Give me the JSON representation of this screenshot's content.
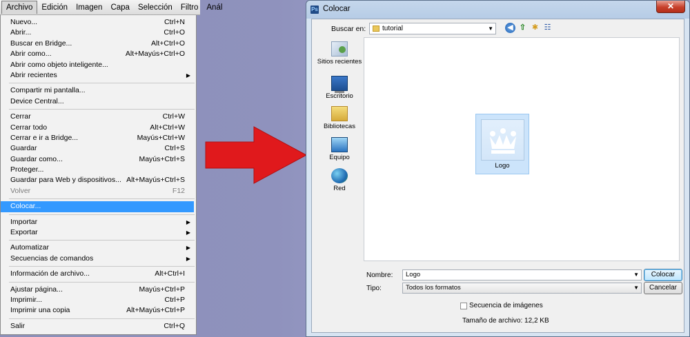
{
  "menubar": {
    "items": [
      {
        "label": "Archivo"
      },
      {
        "label": "Edición"
      },
      {
        "label": "Imagen"
      },
      {
        "label": "Capa"
      },
      {
        "label": "Selección"
      },
      {
        "label": "Filtro"
      },
      {
        "label": "Anál"
      }
    ]
  },
  "menu": {
    "items": [
      {
        "label": "Nuevo...",
        "shortcut": "Ctrl+N"
      },
      {
        "label": "Abrir...",
        "shortcut": "Ctrl+O"
      },
      {
        "label": "Buscar en Bridge...",
        "shortcut": "Alt+Ctrl+O"
      },
      {
        "label": "Abrir como...",
        "shortcut": "Alt+Mayús+Ctrl+O"
      },
      {
        "label": "Abrir como objeto inteligente...",
        "shortcut": ""
      },
      {
        "label": "Abrir recientes",
        "shortcut": ""
      },
      {
        "label": "Compartir mi pantalla...",
        "shortcut": ""
      },
      {
        "label": "Device Central...",
        "shortcut": ""
      },
      {
        "label": "Cerrar",
        "shortcut": "Ctrl+W"
      },
      {
        "label": "Cerrar todo",
        "shortcut": "Alt+Ctrl+W"
      },
      {
        "label": "Cerrar e ir a Bridge...",
        "shortcut": "Mayús+Ctrl+W"
      },
      {
        "label": "Guardar",
        "shortcut": "Ctrl+S"
      },
      {
        "label": "Guardar como...",
        "shortcut": "Mayús+Ctrl+S"
      },
      {
        "label": "Proteger...",
        "shortcut": ""
      },
      {
        "label": "Guardar para Web y dispositivos...",
        "shortcut": "Alt+Mayús+Ctrl+S"
      },
      {
        "label": "Volver",
        "shortcut": "F12"
      },
      {
        "label": "Colocar...",
        "shortcut": ""
      },
      {
        "label": "Importar",
        "shortcut": ""
      },
      {
        "label": "Exportar",
        "shortcut": ""
      },
      {
        "label": "Automatizar",
        "shortcut": ""
      },
      {
        "label": "Secuencias de comandos",
        "shortcut": ""
      },
      {
        "label": "Información de archivo...",
        "shortcut": "Alt+Ctrl+I"
      },
      {
        "label": "Ajustar página...",
        "shortcut": "Mayús+Ctrl+P"
      },
      {
        "label": "Imprimir...",
        "shortcut": "Ctrl+P"
      },
      {
        "label": "Imprimir una copia",
        "shortcut": "Alt+Mayús+Ctrl+P"
      },
      {
        "label": "Salir",
        "shortcut": "Ctrl+Q"
      }
    ]
  },
  "dialog": {
    "title": "Colocar",
    "ps_badge": "Ps",
    "close_label": "✕",
    "lookin_label": "Buscar en:",
    "lookin_value": "tutorial",
    "places": [
      {
        "label": "Sitios recientes"
      },
      {
        "label": "Escritorio"
      },
      {
        "label": "Bibliotecas"
      },
      {
        "label": "Equipo"
      },
      {
        "label": "Red"
      }
    ],
    "file": {
      "label": "Logo",
      "glyph": "♛"
    },
    "name_label": "Nombre:",
    "name_value": "Logo",
    "type_label": "Tipo:",
    "type_value": "Todos los formatos",
    "place_button": "Colocar",
    "cancel_button": "Cancelar",
    "sequence_label": "Secuencia de imágenes",
    "filesize_text": "Tamaño de archivo: 12,2 KB"
  },
  "colors": {
    "highlight": "#3399ff",
    "arrow_red": "#e0191c",
    "background": "#8f92bd"
  }
}
